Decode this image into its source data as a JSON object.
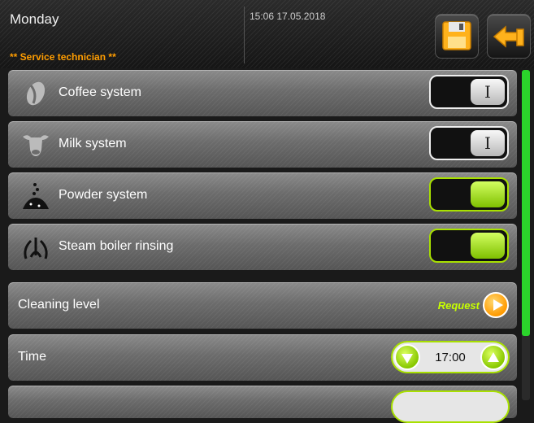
{
  "header": {
    "day": "Monday",
    "datetime": "15:06 17.05.2018",
    "role": "** Service technician **"
  },
  "rows": [
    {
      "label": "Coffee system",
      "icon": "coffee-bean-icon",
      "toggle": "off",
      "knob_glyph": "I"
    },
    {
      "label": "Milk system",
      "icon": "cow-icon",
      "toggle": "off",
      "knob_glyph": "I"
    },
    {
      "label": "Powder system",
      "icon": "powder-icon",
      "toggle": "on"
    },
    {
      "label": "Steam boiler rinsing",
      "icon": "steam-icon",
      "toggle": "on"
    },
    {
      "label": "Cleaning level",
      "action_label": "Request"
    },
    {
      "label": "Time",
      "value": "17:00"
    }
  ],
  "colors": {
    "accent_green": "#a8e000",
    "accent_orange": "#ff9a00",
    "role_text": "#ff9d00",
    "request_text": "#c7ff00",
    "scroll_thumb": "#2bd52b"
  },
  "scrollbar": {
    "position_fraction": 0.0,
    "visible_fraction": 0.8
  }
}
